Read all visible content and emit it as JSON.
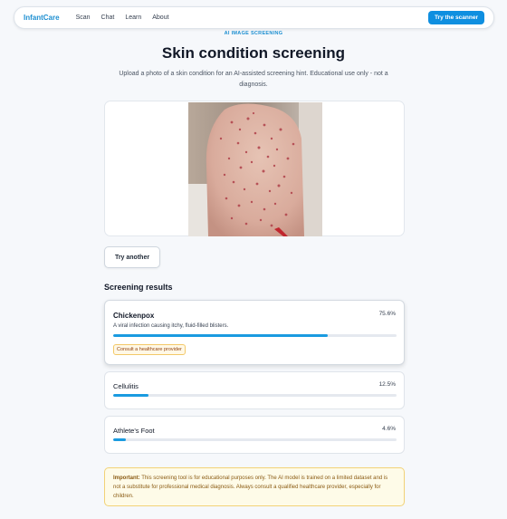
{
  "nav": {
    "brand": "InfantCare",
    "links": [
      "Scan",
      "Chat",
      "Learn",
      "About"
    ],
    "cta": "Try the scanner"
  },
  "hero": {
    "eyebrow": "AI IMAGE SCREENING",
    "title": "Skin condition screening",
    "subtitle": "Upload a photo of a skin condition for an AI-assisted screening hint. Educational use only - not a diagnosis."
  },
  "upload": {
    "image_desc": "photo-of-back-with-rash",
    "try_another": "Try another"
  },
  "results": {
    "title": "Screening results",
    "items": [
      {
        "name": "Chickenpox",
        "percent": "75.6%",
        "value": 75.6,
        "description": "A viral infection causing itchy, fluid-filled blisters.",
        "badge": "Consult a healthcare provider"
      },
      {
        "name": "Cellulitis",
        "percent": "12.5%",
        "value": 12.5
      },
      {
        "name": "Athlete's Foot",
        "percent": "4.6%",
        "value": 4.6
      }
    ]
  },
  "warning": {
    "label": "Important:",
    "text": " This screening tool is for educational purposes only. The AI model is trained on a limited dataset and is not a substitute for professional medical diagnosis. Always consult a qualified healthcare provider, especially for children."
  },
  "colors": {
    "accent": "#1a9be0",
    "brand": "#1d8fd1",
    "warning_bg": "#fefbe8",
    "warning_border": "#f2d277"
  }
}
